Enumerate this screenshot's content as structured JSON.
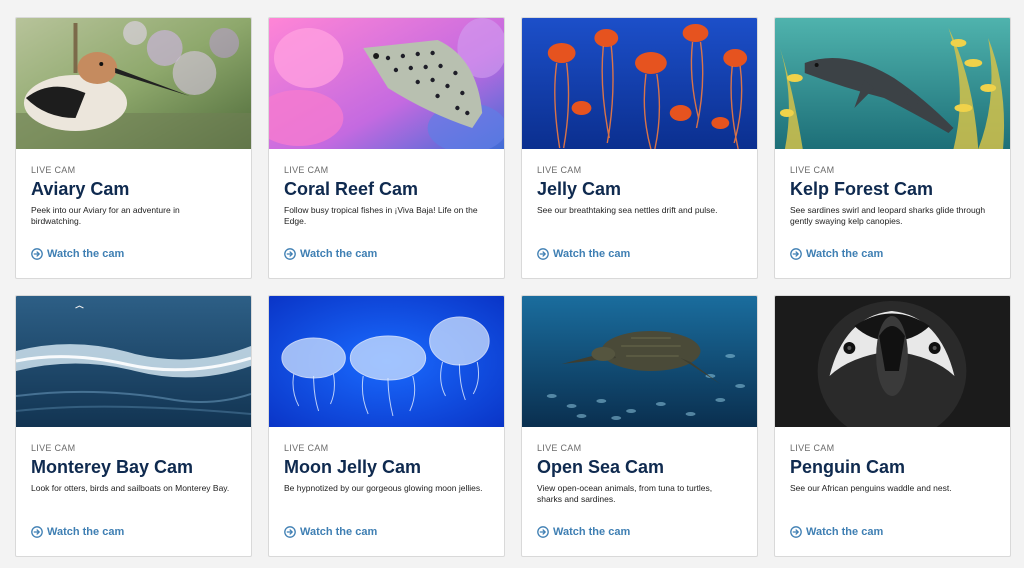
{
  "colors": {
    "page_bg": "#f3f3f3",
    "title": "#0f2a4f",
    "link": "#3f7fb3"
  },
  "cards": [
    {
      "kicker": "LIVE CAM",
      "title": "Aviary Cam",
      "description": "Peek into our Aviary for an adventure in birdwatching.",
      "cta": "Watch the cam",
      "image": "avocet-bird"
    },
    {
      "kicker": "LIVE CAM",
      "title": "Coral Reef Cam",
      "description": "Follow busy tropical fishes in ¡Viva Baja! Life on the Edge.",
      "cta": "Watch the cam",
      "image": "boxfish-coral"
    },
    {
      "kicker": "LIVE CAM",
      "title": "Jelly Cam",
      "description": "See our breathtaking sea nettles drift and pulse.",
      "cta": "Watch the cam",
      "image": "sea-nettles"
    },
    {
      "kicker": "LIVE CAM",
      "title": "Kelp Forest Cam",
      "description": "See sardines swirl and leopard sharks glide through gently swaying kelp canopies.",
      "cta": "Watch the cam",
      "image": "leopard-shark-kelp"
    },
    {
      "kicker": "LIVE CAM",
      "title": "Monterey Bay Cam",
      "description": "Look for otters, birds and sailboats on Monterey Bay.",
      "cta": "Watch the cam",
      "image": "ocean-waves"
    },
    {
      "kicker": "LIVE CAM",
      "title": "Moon Jelly Cam",
      "description": "Be hypnotized by our gorgeous glowing moon jellies.",
      "cta": "Watch the cam",
      "image": "moon-jellies"
    },
    {
      "kicker": "LIVE CAM",
      "title": "Open Sea Cam",
      "description": "View open-ocean animals, from tuna to turtles, sharks and sardines.",
      "cta": "Watch the cam",
      "image": "sea-turtle"
    },
    {
      "kicker": "LIVE CAM",
      "title": "Penguin Cam",
      "description": "See our African penguins waddle and nest.",
      "cta": "Watch the cam",
      "image": "african-penguin"
    }
  ]
}
